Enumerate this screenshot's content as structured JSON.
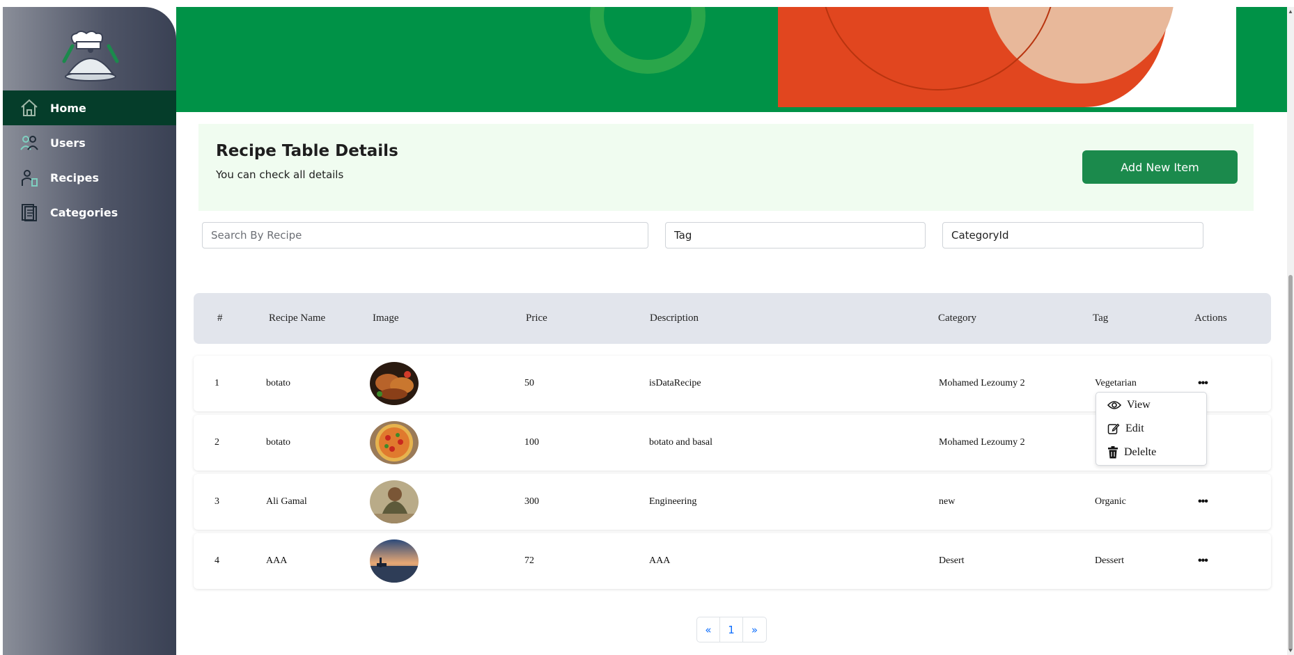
{
  "sidebar": {
    "items": [
      {
        "label": "Home",
        "icon": "home-icon",
        "active": true
      },
      {
        "label": "Users",
        "icon": "users-icon",
        "active": false
      },
      {
        "label": "Recipes",
        "icon": "recipes-icon",
        "active": false
      },
      {
        "label": "Categories",
        "icon": "categories-icon",
        "active": false
      }
    ]
  },
  "header": {
    "title": "Recipe Table Details",
    "subtitle": "You can check all details",
    "add_button": "Add New Item"
  },
  "filters": {
    "search_placeholder": "Search By Recipe",
    "tag": "Tag",
    "category": "CategoryId"
  },
  "table": {
    "columns": [
      "#",
      "Recipe Name",
      "Image",
      "Price",
      "Description",
      "Category",
      "Tag",
      "Actions"
    ],
    "rows": [
      {
        "num": "1",
        "name": "botato",
        "image": "roast-chicken",
        "price": "50",
        "description": "isDataRecipe",
        "category": "Mohamed Lezoumy 2",
        "tag": "Vegetarian"
      },
      {
        "num": "2",
        "name": "botato",
        "image": "pizza",
        "price": "100",
        "description": "botato and basal",
        "category": "Mohamed Lezoumy 2",
        "tag": ""
      },
      {
        "num": "3",
        "name": "Ali Gamal",
        "image": "person",
        "price": "300",
        "description": "Engineering",
        "category": "new",
        "tag": "Organic"
      },
      {
        "num": "4",
        "name": "AAA",
        "image": "sunset",
        "price": "72",
        "description": "AAA",
        "category": "Desert",
        "tag": "Dessert"
      }
    ]
  },
  "actions_menu": {
    "view": "View",
    "edit": "Edit",
    "delete": "Delelte"
  },
  "pagination": {
    "prev": "«",
    "current": "1",
    "next": "»"
  },
  "colors": {
    "brand_green": "#009247",
    "active_nav": "#053d2a",
    "button_green": "#1b8a4c",
    "header_bg": "#f0fcf0"
  }
}
